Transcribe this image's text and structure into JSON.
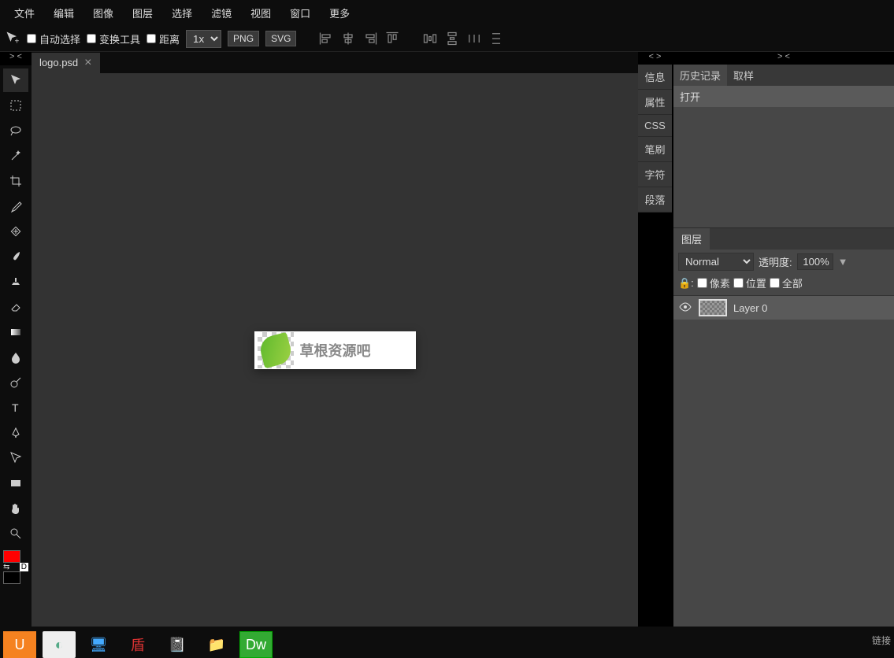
{
  "menu": {
    "items": [
      "文件",
      "编辑",
      "图像",
      "图层",
      "选择",
      "滤镜",
      "视图",
      "窗口",
      "更多"
    ]
  },
  "options": {
    "auto_select": "自动选择",
    "transform_tool": "变换工具",
    "distance": "距离",
    "zoom": "1x",
    "png": "PNG",
    "svg": "SVG"
  },
  "file_tab": {
    "name": "logo.psd"
  },
  "collapse_left": "> <",
  "collapse_right1": "< >",
  "collapse_right2": "> <",
  "fg_color": "#ff0000",
  "bg_color": "#000000",
  "canvas": {
    "logo_text": "草根资源吧"
  },
  "side_tabs": [
    "信息",
    "属性",
    "CSS",
    "笔刷",
    "字符",
    "段落"
  ],
  "history": {
    "tabs": [
      "历史记录",
      "取样"
    ],
    "items": [
      "打开"
    ]
  },
  "layers": {
    "tab": "图层",
    "blend_mode": "Normal",
    "opacity_label": "透明度:",
    "opacity": "100%",
    "lock_pixels": "像素",
    "lock_position": "位置",
    "lock_all": "全部",
    "items": [
      {
        "name": "Layer 0"
      }
    ]
  },
  "status": "链接"
}
